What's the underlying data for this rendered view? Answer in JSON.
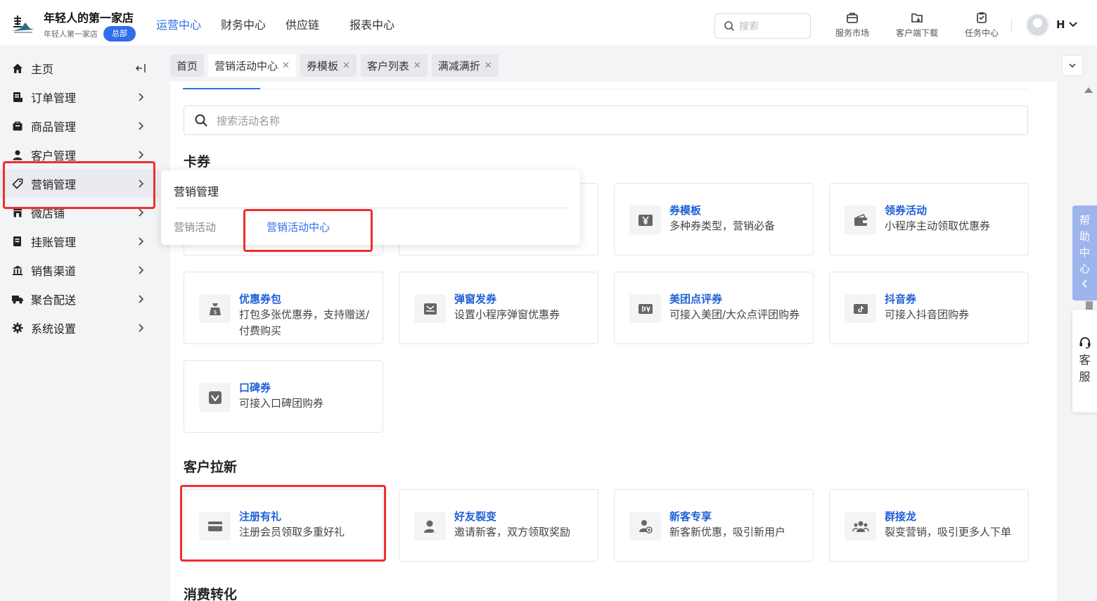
{
  "brand": {
    "name": "年轻人的第一家店",
    "sub": "年轻人第一家店",
    "badge": "总部"
  },
  "topnav": [
    "运营中心",
    "财务中心",
    "供应链",
    "报表中心"
  ],
  "top_search_placeholder": "搜索",
  "tools": [
    "服务市场",
    "客户端下载",
    "任务中心"
  ],
  "user": {
    "name": "H"
  },
  "sidebar": {
    "items": [
      {
        "label": "主页",
        "icon": "home-icon"
      },
      {
        "label": "订单管理",
        "icon": "order-icon"
      },
      {
        "label": "商品管理",
        "icon": "goods-icon"
      },
      {
        "label": "客户管理",
        "icon": "user-icon"
      },
      {
        "label": "营销管理",
        "icon": "tag-icon"
      },
      {
        "label": "微店铺",
        "icon": "shop-icon"
      },
      {
        "label": "挂账管理",
        "icon": "bill-icon"
      },
      {
        "label": "销售渠道",
        "icon": "bank-icon"
      },
      {
        "label": "聚合配送",
        "icon": "truck-icon"
      },
      {
        "label": "系统设置",
        "icon": "gear-icon"
      }
    ]
  },
  "tabs": [
    {
      "label": "首页",
      "closable": false
    },
    {
      "label": "营销活动中心",
      "closable": true,
      "active": true
    },
    {
      "label": "券模板",
      "closable": true
    },
    {
      "label": "客户列表",
      "closable": true
    },
    {
      "label": "满减满折",
      "closable": true
    }
  ],
  "search_placeholder": "搜索活动名称",
  "sections": {
    "cards_title": "卡券",
    "acquisition_title": "客户拉新",
    "conversion_title": "消费转化"
  },
  "coupon_cards": [
    {
      "title": "券模板",
      "desc": "多种券类型，营销必备"
    },
    {
      "title": "领券活动",
      "desc": "小程序主动领取优惠券"
    },
    {
      "title": "优惠券包",
      "desc": "打包多张优惠券，支持赠送/付费购买"
    },
    {
      "title": "弹窗发券",
      "desc": "设置小程序弹窗优惠券"
    },
    {
      "title": "美团点评券",
      "desc": "可接入美团/大众点评团购券"
    },
    {
      "title": "抖音券",
      "desc": "可接入抖音团购券"
    },
    {
      "title": "口碑券",
      "desc": "可接入口碑团购券"
    }
  ],
  "acquisition_cards": [
    {
      "title": "注册有礼",
      "desc": "注册会员领取多重好礼"
    },
    {
      "title": "好友裂变",
      "desc": "邀请新客，双方领取奖励"
    },
    {
      "title": "新客专享",
      "desc": "新客新优惠，吸引新用户"
    },
    {
      "title": "群接龙",
      "desc": "裂变营销，吸引更多人下单"
    }
  ],
  "flyout": {
    "title": "营销管理",
    "group": "营销活动",
    "link": "营销活动中心"
  },
  "help": {
    "chars": [
      "帮",
      "助",
      "中",
      "心"
    ],
    "service": [
      "客",
      "服"
    ]
  },
  "colors": {
    "accent": "#2f6fe8",
    "highlight": "#ef2f2f"
  }
}
